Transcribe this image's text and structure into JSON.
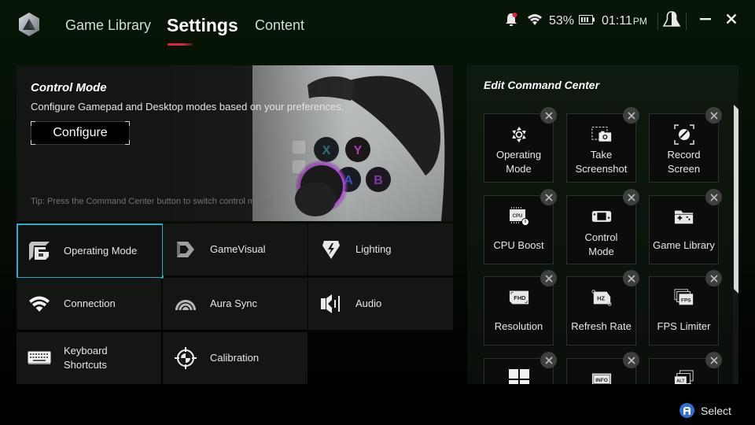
{
  "header": {
    "tabs": [
      {
        "label": "Game Library",
        "active": false
      },
      {
        "label": "Settings",
        "active": true
      },
      {
        "label": "Content",
        "active": false
      }
    ],
    "status": {
      "notification_icon": "bell-icon",
      "wifi_icon": "wifi-icon",
      "battery_percent": "53%",
      "battery_icon": "battery-icon",
      "time": "01:11",
      "ampm": "PM",
      "profile_icon": "user-icon",
      "minimize_icon": "minimize-icon",
      "close_icon": "close-icon"
    },
    "accent_color": "#e0243f"
  },
  "control_mode": {
    "title": "Control Mode",
    "description": "Configure Gamepad and Desktop modes based on your preferences.",
    "button_label": "Configure",
    "tip": "Tip: Press the Command Center button to switch control modes"
  },
  "settings_tiles": [
    {
      "label": "Operating Mode",
      "icon": "operating-mode-icon",
      "selected": true
    },
    {
      "label": "GameVisual",
      "icon": "gamevisual-icon",
      "selected": false
    },
    {
      "label": "Lighting",
      "icon": "lighting-icon",
      "selected": false
    },
    {
      "label": "Connection",
      "icon": "wifi-icon",
      "selected": false
    },
    {
      "label": "Aura Sync",
      "icon": "aura-sync-icon",
      "selected": false
    },
    {
      "label": "Audio",
      "icon": "audio-icon",
      "selected": false
    },
    {
      "label": "Keyboard\nShortcuts",
      "icon": "keyboard-icon",
      "selected": false
    },
    {
      "label": "Calibration",
      "icon": "calibration-icon",
      "selected": false
    }
  ],
  "selection_color": "#2aa7c9",
  "command_center": {
    "title": "Edit Command Center",
    "items": [
      {
        "label": "Operating\nMode",
        "icon": "operating-mode-shutter-icon"
      },
      {
        "label": "Take\nScreenshot",
        "icon": "screenshot-icon"
      },
      {
        "label": "Record\nScreen",
        "icon": "record-screen-icon"
      },
      {
        "label": "CPU Boost",
        "icon": "cpu-boost-icon"
      },
      {
        "label": "Control\nMode",
        "icon": "control-mode-icon"
      },
      {
        "label": "Game Library",
        "icon": "game-library-icon"
      },
      {
        "label": "Resolution",
        "icon": "resolution-icon"
      },
      {
        "label": "Refresh Rate",
        "icon": "refresh-rate-icon"
      },
      {
        "label": "FPS Limiter",
        "icon": "fps-limiter-icon"
      },
      {
        "label": "",
        "icon": "windows-icon"
      },
      {
        "label": "",
        "icon": "info-icon"
      },
      {
        "label": "",
        "icon": "alt-tab-icon"
      }
    ],
    "remove_icon": "remove-x-icon"
  },
  "footer": {
    "button_glyph": "A",
    "label": "Select"
  }
}
